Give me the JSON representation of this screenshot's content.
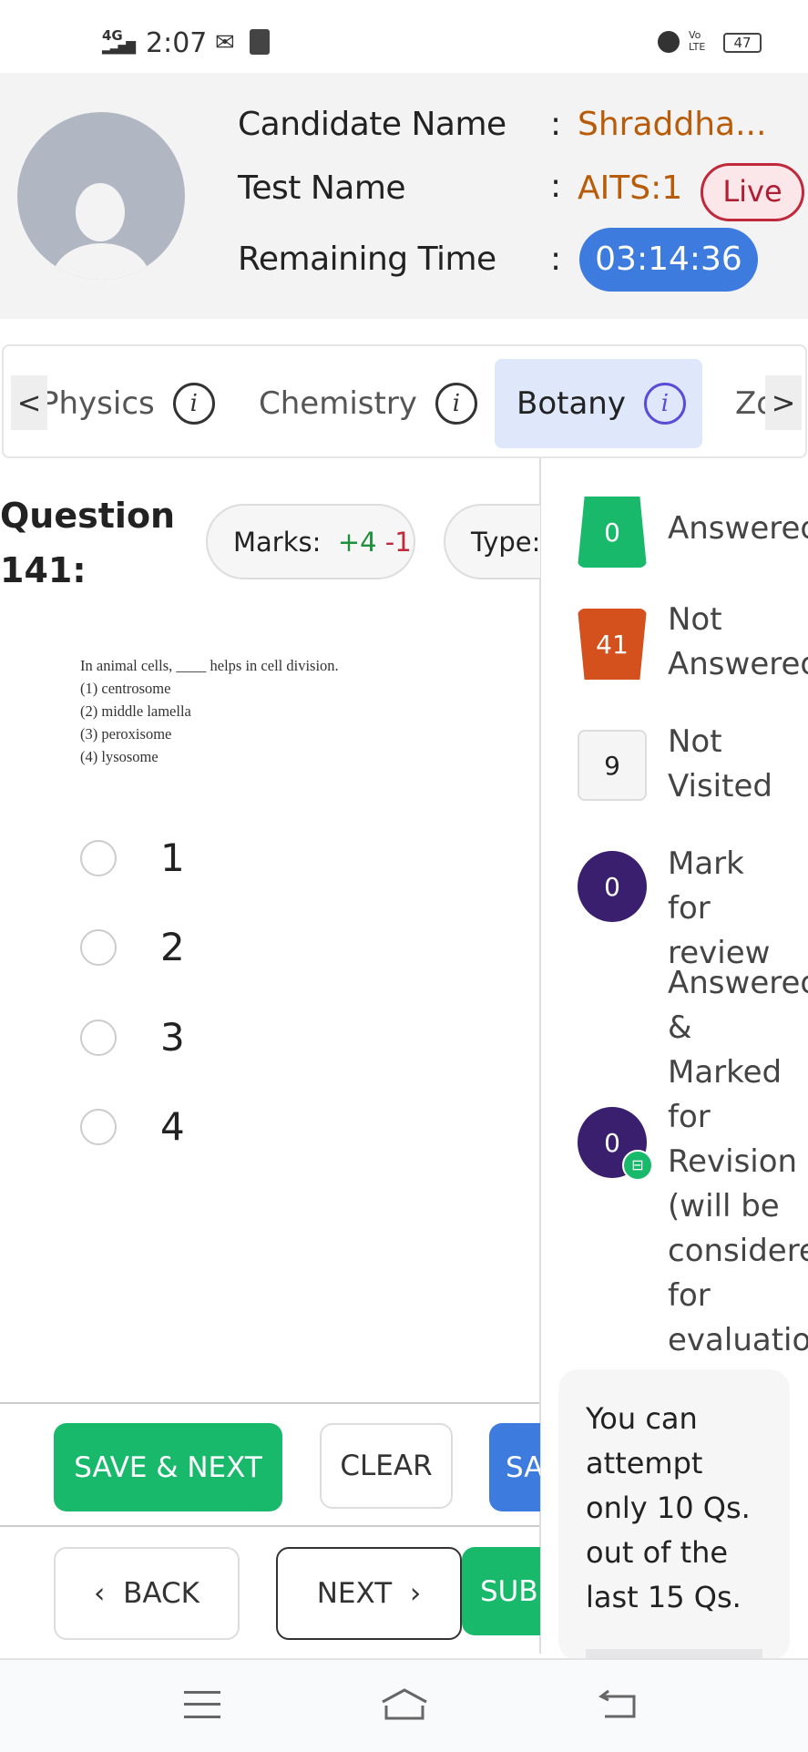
{
  "status_bar": {
    "network": "4G",
    "time": "2:07",
    "battery": "47",
    "volte": "Vo LTE"
  },
  "header": {
    "candidate_label": "Candidate Name",
    "candidate_value": "Shraddha...",
    "test_label": "Test Name",
    "test_value": "AITS:1",
    "live_badge": "Live",
    "time_label": "Remaining Time",
    "time_value": "03:14:36",
    "colon": ":"
  },
  "tabs": {
    "items": [
      {
        "label": "Physics"
      },
      {
        "label": "Chemistry"
      },
      {
        "label": "Botany",
        "active": true
      },
      {
        "label": "Zo"
      }
    ],
    "prev": "<",
    "next": ">",
    "info": "i"
  },
  "question": {
    "title_line1": "Question",
    "title_line2": "141:",
    "marks_label": "Marks:",
    "marks_plus": "+4",
    "marks_minus": "-1",
    "type_label": "Type:",
    "text": "In animal cells, ____ helps in cell division.",
    "choices_text": [
      "(1)  centrosome",
      "(2)  middle lamella",
      "(3)  peroxisome",
      "(4)  lysosome"
    ],
    "options": [
      "1",
      "2",
      "3",
      "4"
    ]
  },
  "legend": [
    {
      "count": "0",
      "label": "Answered",
      "color": "#19b96b"
    },
    {
      "count": "41",
      "label": "Not Answered",
      "color": "#d4511e"
    },
    {
      "count": "9",
      "label": "Not Visited",
      "color": "#f5f5f5"
    },
    {
      "count": "0",
      "label": "Mark for review",
      "color": "#3a1f6e"
    },
    {
      "count": "0",
      "label": "Answered & Marked for Revision (will be considered for evaluation",
      "color": "#3a1f6e"
    }
  ],
  "info_box": {
    "text": "You can attempt only 10 Qs. out of the last 15 Qs."
  },
  "buttons": {
    "save_next": "SAVE & NEXT",
    "clear": "CLEAR",
    "save_mark": "SA",
    "back": "BACK",
    "next": "NEXT",
    "submit": "SUB"
  },
  "colors": {
    "accent_green": "#19b96b",
    "accent_blue": "#3d7bde",
    "timer_blue": "#3d7bde",
    "live_red": "#c0283b"
  }
}
